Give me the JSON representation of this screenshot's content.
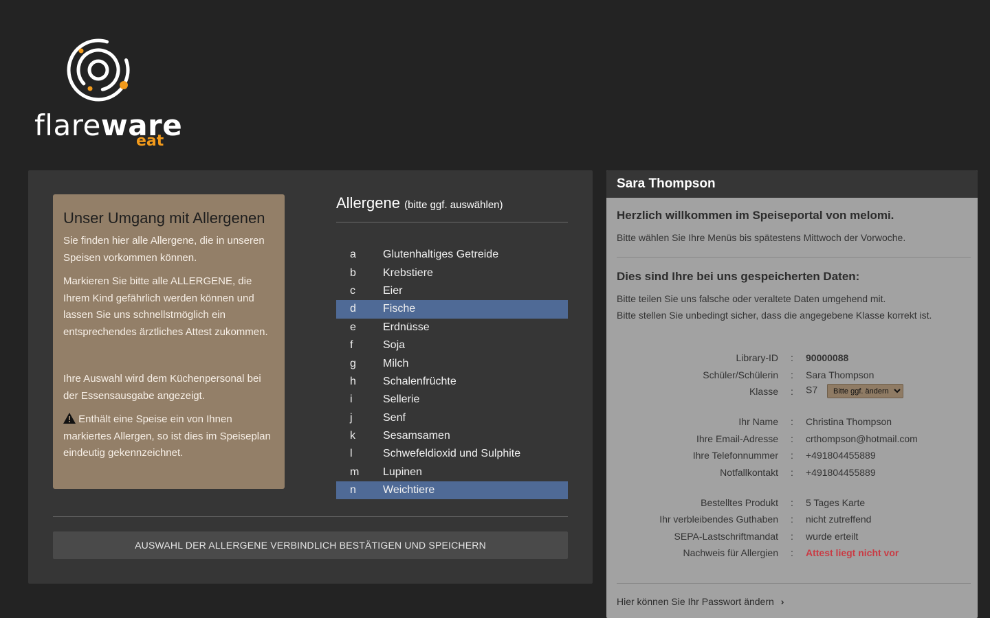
{
  "logo": {
    "word_light": "flare",
    "word_bold": "ware",
    "sub": "eat",
    "accent_color": "#f29a1b"
  },
  "info": {
    "title": "Unser Umgang mit Allergenen",
    "p1": "Sie finden hier alle Allergene, die in unseren Speisen vorkommen können.",
    "p2": "Markieren Sie bitte alle ALLERGENE, die Ihrem Kind gefährlich werden können und lassen Sie uns schnellstmöglich ein entsprechendes ärztliches Attest zukommen.",
    "p3": "Ihre Auswahl wird dem Küchenpersonal bei der Essensausgabe angezeigt.",
    "p4": "Enthält eine Speise ein von Ihnen markiertes Allergen, so ist dies im Speiseplan eindeutig gekennzeichnet."
  },
  "allergens": {
    "title": "Allergene",
    "subtitle": "(bitte ggf. auswählen)",
    "items": [
      {
        "code": "a",
        "name": "Glutenhaltiges Getreide",
        "selected": false
      },
      {
        "code": "b",
        "name": "Krebstiere",
        "selected": false
      },
      {
        "code": "c",
        "name": "Eier",
        "selected": false
      },
      {
        "code": "d",
        "name": "Fische",
        "selected": true
      },
      {
        "code": "e",
        "name": "Erdnüsse",
        "selected": false
      },
      {
        "code": "f",
        "name": "Soja",
        "selected": false
      },
      {
        "code": "g",
        "name": "Milch",
        "selected": false
      },
      {
        "code": "h",
        "name": "Schalenfrüchte",
        "selected": false
      },
      {
        "code": "i",
        "name": "Sellerie",
        "selected": false
      },
      {
        "code": "j",
        "name": "Senf",
        "selected": false
      },
      {
        "code": "k",
        "name": "Sesamsamen",
        "selected": false
      },
      {
        "code": "l",
        "name": "Schwefeldioxid und Sulphite",
        "selected": false
      },
      {
        "code": "m",
        "name": "Lupinen",
        "selected": false
      },
      {
        "code": "n",
        "name": "Weichtiere",
        "selected": true
      }
    ],
    "confirm_label": "Auswahl der Allergene verbindlich bestätigen und speichern"
  },
  "user": {
    "name": "Sara Thompson",
    "welcome_title": "Herzlich willkommen im Speiseportal von melomi.",
    "welcome_text": "Bitte wählen Sie Ihre Menüs bis spätestens Mittwoch der Vorwoche.",
    "data_title": "Dies sind Ihre bei uns gespeicherten Daten:",
    "data_text1": "Bitte teilen Sie uns falsche oder veraltete Daten umgehend mit.",
    "data_text2": "Bitte stellen Sie unbedingt sicher, dass die angegebene Klasse korrekt ist.",
    "fields": {
      "library_id_label": "Library-ID",
      "library_id": "90000088",
      "student_label": "Schüler/Schülerin",
      "student": "Sara Thompson",
      "class_label": "Klasse",
      "class": "S7",
      "class_select": "Bitte ggf. ändern",
      "name_label": "Ihr Name",
      "name": "Christina Thompson",
      "email_label": "Ihre Email-Adresse",
      "email": "crthompson@hotmail.com",
      "phone_label": "Ihre Telefonnummer",
      "phone": "+491804455889",
      "emergency_label": "Notfallkontakt",
      "emergency": "+491804455889",
      "product_label": "Bestelltes Produkt",
      "product": "5 Tages Karte",
      "balance_label": "Ihr verbleibendes Guthaben",
      "balance": "nicht zutreffend",
      "sepa_label": "SEPA-Lastschriftmandat",
      "sepa": "wurde erteilt",
      "allergy_label": "Nachweis für Allergien",
      "allergy": "Attest liegt nicht vor"
    },
    "colon": ":",
    "password_link": "Hier können Sie Ihr Passwort ändern"
  }
}
